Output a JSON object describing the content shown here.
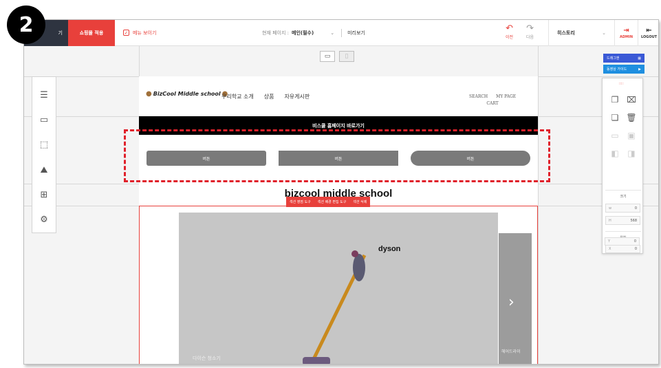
{
  "step_badge": "2",
  "toolbar": {
    "left_dark_label": "기",
    "shop_apply_label": "쇼핑몰 적용",
    "show_menu_label": "메뉴 보이기",
    "current_page_label": "현재 페이지 :",
    "current_page_value": "메인(필수)",
    "preview_label": "미리보기",
    "undo_label": "이전",
    "redo_label": "다음",
    "history_label": "히스토리",
    "admin_label": "ADMIN",
    "logout_label": "LOGOUT"
  },
  "site": {
    "logo_text": "BizCool Middle school",
    "nav": [
      "우리학교 소개",
      "상품",
      "자유게시판"
    ],
    "util_top": [
      "SEARCH",
      "MY PAGE"
    ],
    "util_bottom": "CART",
    "banner_text": "비스쿨 홈페이지 바로가기",
    "buttons": [
      "버튼",
      "버튼",
      "버튼"
    ],
    "section_title": "bizcool middle school",
    "section_tools": [
      "섹션 영점 도구",
      "섹션 배경 편집 도구",
      "섹션 삭제"
    ],
    "slide_brand": "dyson",
    "slide_caption": "다이슨 청소기",
    "slide_next_caption": "헤어드라이"
  },
  "right_panel": {
    "drag_layout_label": "드래그앤",
    "video_guide_label": "동영상 가이드",
    "size_label": "크기",
    "width_key": "w",
    "width_value": "0",
    "height_key": "H",
    "height_value": "568",
    "position_label": "위치",
    "x_key": "X",
    "x_value": "0",
    "y_key": "Y",
    "y_value": "0"
  },
  "colors": {
    "accent_red": "#e8403b",
    "dark_nav": "#2e3440",
    "blue_primary": "#3a59d6",
    "blue_secondary": "#1f8fe0",
    "highlight_dash": "#e0202a"
  }
}
